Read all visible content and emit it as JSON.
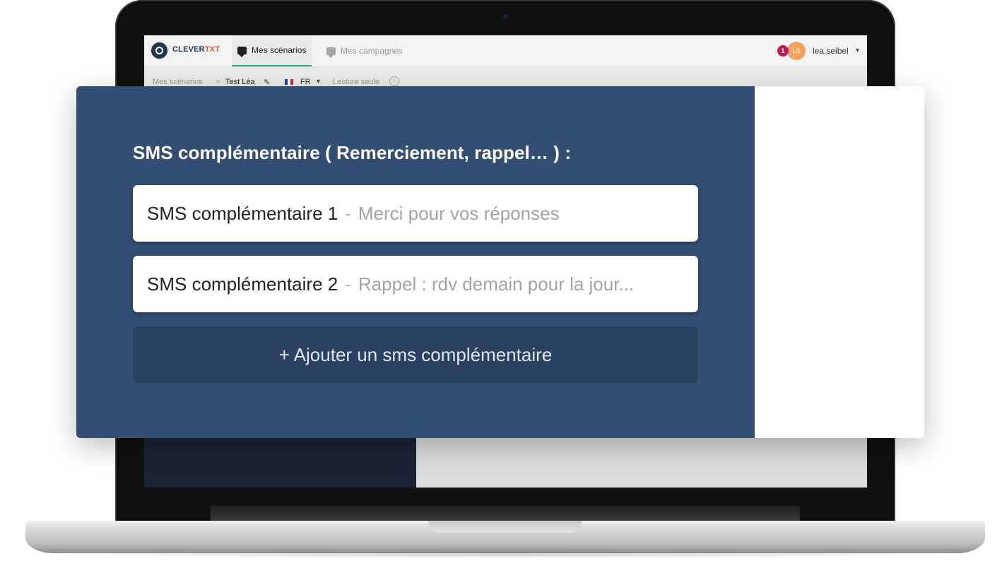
{
  "app": {
    "brand_main": "CLEVER",
    "brand_accent": "TXT",
    "nav_tabs": [
      {
        "label": "Mes scénarios",
        "active": true,
        "icon": "chat-icon"
      },
      {
        "label": "Mes campagnes",
        "active": false,
        "icon": "chat-icon"
      }
    ],
    "notification_count": "1",
    "avatar_initials": "LS",
    "username": "lea.seibel"
  },
  "breadcrumb": {
    "root": "Mes scénarios",
    "separator": ">",
    "current": "Test Léa",
    "language": "FR",
    "mode": "Lecture seule",
    "info_glyph": "i"
  },
  "overlay": {
    "title": "SMS complémentaire ( Remerciement, rappel… ) :",
    "sms_items": [
      {
        "name": "SMS complémentaire 1",
        "separator": "-",
        "preview": "Merci pour vos réponses"
      },
      {
        "name": "SMS complémentaire 2",
        "separator": "-",
        "preview": "Rappel : rdv demain pour la jour..."
      }
    ],
    "add_button_label": "+ Ajouter un sms complémentaire"
  },
  "colors": {
    "panel_bg": "#324e72",
    "add_button_bg": "#2a4161",
    "brand_dark": "#1f3550",
    "brand_accent": "#e4502f",
    "notification": "#c2185b",
    "avatar": "#f0a45b",
    "active_tab_underline": "#2aa37a"
  }
}
